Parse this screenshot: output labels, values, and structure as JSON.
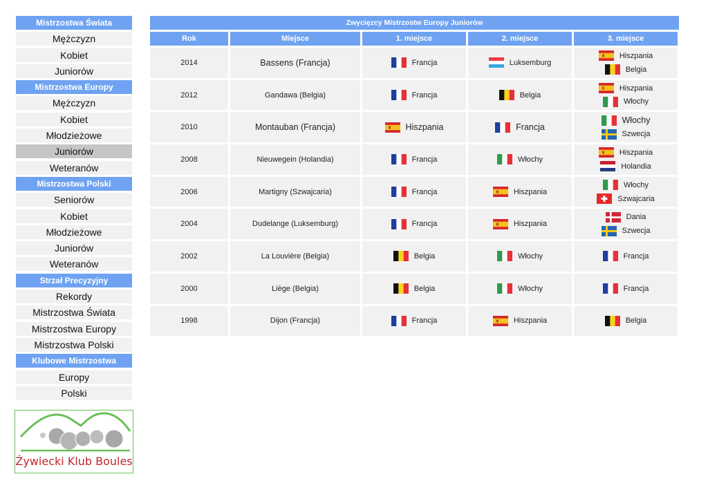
{
  "sidebar": {
    "sections": [
      {
        "title": "Mistrzostwa Świata",
        "items": [
          "Mężczyzn",
          "Kobiet",
          "Juniorów"
        ]
      },
      {
        "title": "Mistrzostwa Europy",
        "items": [
          "Mężczyzn",
          "Kobiet",
          "Młodzieżowe",
          "Juniorów",
          "Weteranów"
        ],
        "active": 3
      },
      {
        "title": "Mistrzostwa Polski",
        "items": [
          "Seniorów",
          "Kobiet",
          "Młodzieżowe",
          "Juniorów",
          "Weteranów"
        ]
      },
      {
        "title": "Strzał Precyzyjny",
        "items": [
          "Rekordy",
          "Mistrzostwa Świata",
          "Mistrzostwa Europy",
          "Mistrzostwa Polski"
        ]
      },
      {
        "title": "Klubowe Mistrzostwa",
        "items": [
          "Europy",
          "Polski"
        ]
      }
    ]
  },
  "logo": {
    "text": "Żywiecki Klub Boules"
  },
  "table": {
    "title": "Zwycięzcy Mistrzostw Europy Juniorów",
    "headers": [
      "Rok",
      "Miejsce",
      "1. miejsce",
      "2. miejsce",
      "3. miejsce"
    ],
    "rows": [
      {
        "year": "2014",
        "place": "Bassens (Francja)",
        "place_large": true,
        "first": {
          "flag": "france",
          "name": "Francja"
        },
        "second": {
          "flag": "luxembourg",
          "name": "Luksemburg"
        },
        "third": [
          {
            "flag": "spain",
            "name": "Hiszpania"
          },
          {
            "flag": "belgium",
            "name": "Belgia"
          }
        ]
      },
      {
        "year": "2012",
        "place": "Gandawa (Belgia)",
        "first": {
          "flag": "france",
          "name": "Francja"
        },
        "second": {
          "flag": "belgium",
          "name": "Belgia"
        },
        "third": [
          {
            "flag": "spain",
            "name": "Hiszpania"
          },
          {
            "flag": "italy",
            "name": "Włochy"
          }
        ]
      },
      {
        "year": "2010",
        "place": "Montauban (Francja)",
        "place_large": true,
        "first": {
          "flag": "spain",
          "name": "Hiszpania",
          "large": true
        },
        "second": {
          "flag": "france",
          "name": "Francja",
          "large": true
        },
        "third": [
          {
            "flag": "italy",
            "name": "Włochy",
            "large": true
          },
          {
            "flag": "sweden",
            "name": "Szwecja"
          }
        ]
      },
      {
        "year": "2008",
        "place": "Nieuwegein (Holandia)",
        "first": {
          "flag": "france",
          "name": "Francja"
        },
        "second": {
          "flag": "italy",
          "name": "Włochy"
        },
        "third": [
          {
            "flag": "spain",
            "name": "Hiszpania"
          },
          {
            "flag": "netherlands",
            "name": "Holandia"
          }
        ]
      },
      {
        "year": "2006",
        "place": "Martigny (Szwajcaria)",
        "first": {
          "flag": "france",
          "name": "Francja"
        },
        "second": {
          "flag": "spain",
          "name": "Hiszpania"
        },
        "third": [
          {
            "flag": "italy",
            "name": "Włochy"
          },
          {
            "flag": "switzerland",
            "name": "Szwajcaria"
          }
        ]
      },
      {
        "year": "2004",
        "place": "Dudelange (Luksemburg)",
        "first": {
          "flag": "france",
          "name": "Francja"
        },
        "second": {
          "flag": "spain",
          "name": "Hiszpania"
        },
        "third": [
          {
            "flag": "denmark",
            "name": "Dania"
          },
          {
            "flag": "sweden",
            "name": "Szwecja"
          }
        ]
      },
      {
        "year": "2002",
        "place": "La Louvière (Belgia)",
        "first": {
          "flag": "belgium",
          "name": "Belgia"
        },
        "second": {
          "flag": "italy",
          "name": "Włochy"
        },
        "third": [
          {
            "flag": "france",
            "name": "Francja"
          }
        ]
      },
      {
        "year": "2000",
        "place": "Liège (Belgia)",
        "first": {
          "flag": "belgium",
          "name": "Belgia"
        },
        "second": {
          "flag": "italy",
          "name": "Włochy"
        },
        "third": [
          {
            "flag": "france",
            "name": "Francja"
          }
        ]
      },
      {
        "year": "1998",
        "place": "Dijon (Francja)",
        "first": {
          "flag": "france",
          "name": "Francja"
        },
        "second": {
          "flag": "spain",
          "name": "Hiszpania"
        },
        "third": [
          {
            "flag": "belgium",
            "name": "Belgia"
          }
        ]
      }
    ]
  },
  "colors": {
    "accent": "#6fa3f1",
    "cell": "#f1f1f1",
    "active": "#c6c6c6",
    "logo_text": "#c1272d",
    "logo_green": "#6bbf59"
  }
}
